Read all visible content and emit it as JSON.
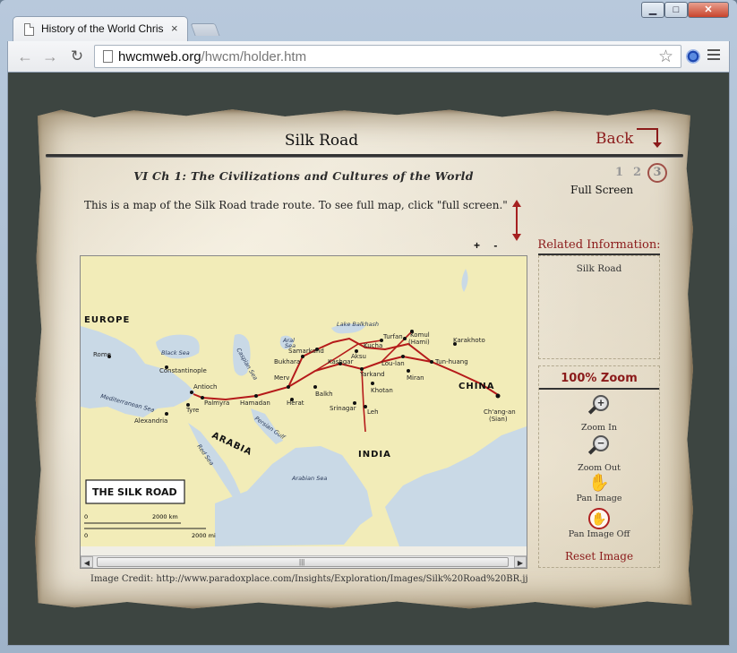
{
  "browser": {
    "tab_title": "History of the World Chris",
    "tab_close": "×",
    "url_host": "hwcmweb.org",
    "url_path": "/hwcm/holder.htm",
    "window_controls": {
      "minimize": "▁",
      "maximize": "□",
      "close": "✕"
    }
  },
  "page": {
    "title": "Silk Road",
    "back_label": "Back",
    "chapter": "VI Ch 1: The Civilizations and Cultures of the World",
    "page_numbers": [
      "1",
      "2",
      "3"
    ],
    "current_page": "3",
    "fullscreen_label": "Full Screen",
    "intro": "This is a map of the Silk Road trade route. To see full map, click \"full screen.\"",
    "zoom_plus_minus": "+ -",
    "credit": "Image Credit: http://www.paradoxplace.com/Insights/Exploration/Images/Silk%20Road%20BR.jj"
  },
  "map": {
    "title_box": "THE SILK ROAD",
    "regions": [
      "EUROPE",
      "ARABIA",
      "INDIA",
      "CHINA"
    ],
    "seas": [
      "Black Sea",
      "Caspian Sea",
      "Aral Sea",
      "Lake Balkhash",
      "Mediterranean Sea",
      "Persian Gulf",
      "Red Sea",
      "Arabian Sea"
    ],
    "cities": [
      "Rome",
      "Constantinople",
      "Antioch",
      "Tyre",
      "Palmyra",
      "Alexandria",
      "Hamadan",
      "Merv",
      "Bukhara",
      "Samarkand",
      "Kashgar",
      "Aksu",
      "Kucha",
      "Turfan",
      "Komul (Hami)",
      "Karakhoto",
      "Lou-lan",
      "Tun-huang",
      "Yarkand",
      "Miran",
      "Khotan",
      "Balkh",
      "Herat",
      "Srinagar",
      "Leh",
      "Ch'ang-an (Sian)"
    ],
    "scale_km": "2000 km",
    "scale_mi": "2000 mi",
    "scale_zero": "0",
    "colors": {
      "land": "#f2ecb8",
      "sea": "#c9d9e6",
      "route": "#b51a1a"
    }
  },
  "sidebar": {
    "related_title": "Related Information:",
    "related_items": [
      "Silk Road"
    ],
    "zoom_level": "100% Zoom",
    "tools": {
      "zoom_in": "Zoom In",
      "zoom_out": "Zoom Out",
      "pan": "Pan Image",
      "pan_off": "Pan Image Off"
    },
    "reset": "Reset Image"
  }
}
